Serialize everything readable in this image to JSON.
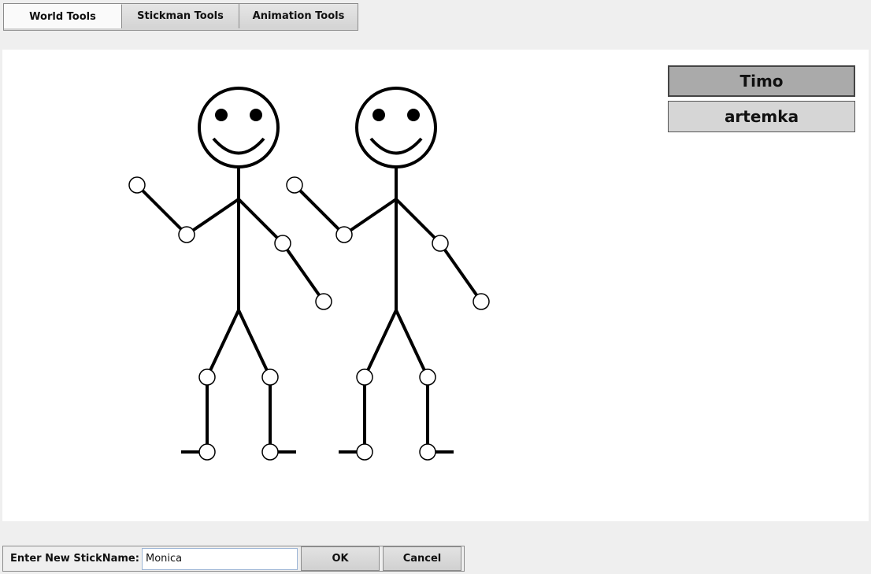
{
  "tabs": [
    {
      "label": "World Tools",
      "active": true
    },
    {
      "label": "Stickman Tools",
      "active": false
    },
    {
      "label": "Animation Tools",
      "active": false
    }
  ],
  "stickmen_list": [
    {
      "name": "Timo",
      "selected": true
    },
    {
      "name": "artemka",
      "selected": false
    }
  ],
  "canvas": {
    "background": "#ffffff",
    "figures": [
      "stickman",
      "stickman"
    ]
  },
  "bottom_bar": {
    "prompt_label": "Enter New StickName:",
    "input_value": "Monica",
    "ok_label": "OK",
    "cancel_label": "Cancel"
  },
  "colors": {
    "window_bg": "#efefef",
    "selected_item_bg": "#aaaaaa",
    "item_bg": "#d6d6d6",
    "stroke": "#000000"
  }
}
